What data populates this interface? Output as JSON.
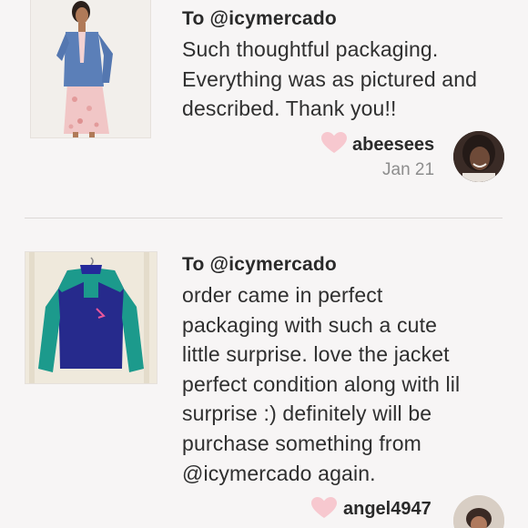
{
  "reviews": [
    {
      "to": "To @icymercado",
      "message": "Such thoughtful packaging.\nEverything was as pictured and\ndescribed. Thank you!!",
      "username": "abeesees",
      "date": "Jan 21",
      "heart_icon": "heart-icon",
      "heart_color": "#f7c8cf"
    },
    {
      "to": "To @icymercado",
      "message": "order came in perfect\npackaging with such a cute\nlittle surprise. love the jacket\nperfect condition along with lil\nsurprise :) definitely will be\npurchase something from\n@icymercado again.",
      "username": "angel4947",
      "heart_icon": "heart-icon",
      "heart_color": "#f7c8cf"
    }
  ],
  "colors": {
    "background": "#f7f5f5",
    "divider": "#dcd8d6",
    "date_text": "#8d8d8d"
  }
}
